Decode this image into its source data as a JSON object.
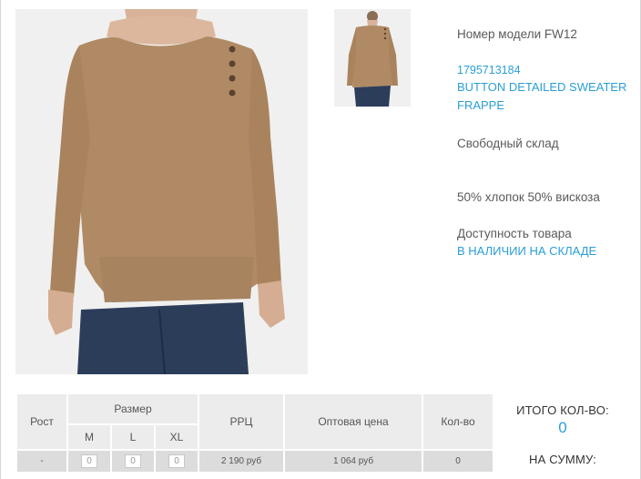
{
  "product": {
    "model_label": "Номер модели FW12",
    "sku": "1795713184",
    "name": "BUTTON DETAILED SWEATER FRAPPE",
    "stock_type": "Свободный склад",
    "composition": "50% хлопок 50% вискоза",
    "availability_label": "Доступность товара",
    "availability_value": "В НАЛИЧИИ НА СКЛАДЕ",
    "image_main_icon": "sweater-photo",
    "image_thumb_icon": "sweater-photo-thumb"
  },
  "colors": {
    "accent": "#2a9fd6",
    "sweater": "#b08a64",
    "jeans": "#2c3d5a",
    "table_header": "#ececec",
    "table_row": "#dcdcdc"
  },
  "order_table": {
    "headers": {
      "rost": "Рост",
      "size": "Размер",
      "rrc": "РРЦ",
      "wholesale": "Оптовая цена",
      "qty": "Кол-во"
    },
    "sizes": [
      "M",
      "L",
      "XL"
    ],
    "row": {
      "rost": "-",
      "size_values": [
        "0",
        "0",
        "0"
      ],
      "rrc": "2 190 руб",
      "wholesale": "1 064 руб",
      "qty": "0"
    }
  },
  "totals": {
    "qty_label": "ИТОГО КОЛ-ВО:",
    "qty_value": "0",
    "sum_label": "НА СУММУ:"
  }
}
